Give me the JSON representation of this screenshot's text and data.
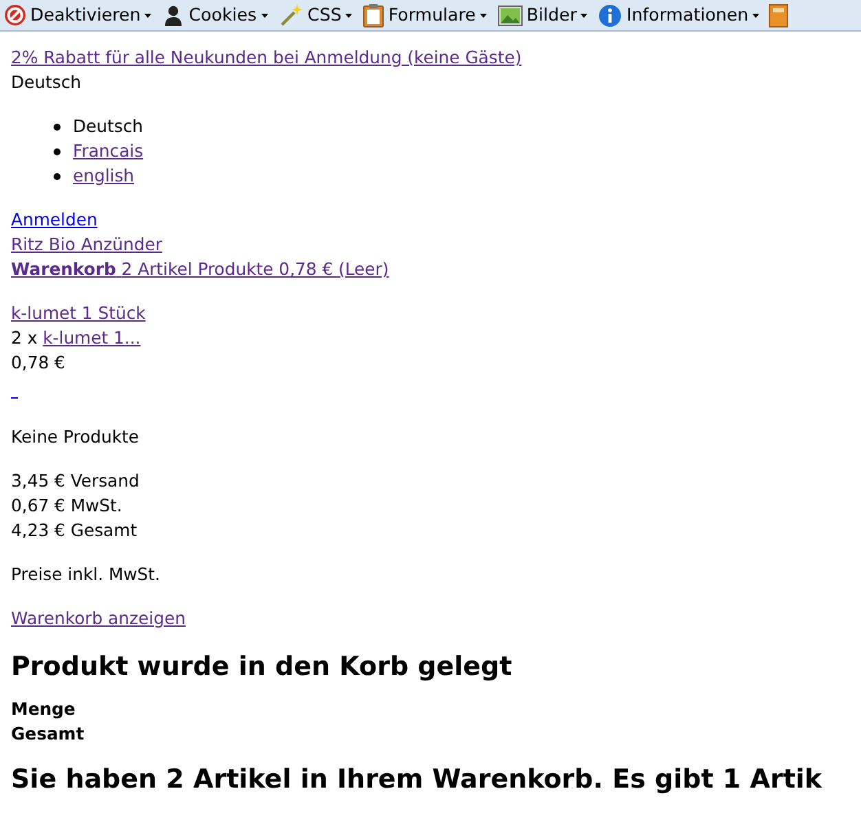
{
  "toolbar": {
    "items": [
      {
        "kind": "disable",
        "label": "Deaktivieren"
      },
      {
        "kind": "cookies",
        "label": "Cookies"
      },
      {
        "kind": "css",
        "label": "CSS"
      },
      {
        "kind": "forms",
        "label": "Formulare"
      },
      {
        "kind": "images",
        "label": "Bilder"
      },
      {
        "kind": "info",
        "label": "Informationen"
      },
      {
        "kind": "misc"
      }
    ]
  },
  "promo": {
    "text": "2% Rabatt für alle Neukunden bei Anmeldung (keine Gäste)",
    "visited": true
  },
  "language": {
    "current": "Deutsch",
    "options": [
      {
        "label": "Deutsch",
        "selected": true
      },
      {
        "label": "Francais",
        "selected": false
      },
      {
        "label": "english",
        "selected": false
      }
    ]
  },
  "account_links": [
    {
      "text": "Anmelden",
      "visited": false
    },
    {
      "text": "Ritz Bio Anzünder",
      "visited": true
    }
  ],
  "cart_link": {
    "title": "Warenkorb",
    "summary": "2 Artikel Produkte 0,78 € (Leer)",
    "visited": true
  },
  "cart_item": {
    "name_link": "k-lumet 1 Stück",
    "quantity": "2 x",
    "short_link": "k-lumet 1...",
    "price": "0,78 €"
  },
  "empty_text": "Keine Produkte",
  "totals": [
    "3,45 € Versand",
    "0,67 € MwSt.",
    "4,23 € Gesamt"
  ],
  "tax_note": "Preise inkl. MwSt.",
  "show_cart_link": "Warenkorb anzeigen",
  "added_heading": "Produkt wurde in den Korb gelegt",
  "labels": [
    "Menge",
    "Gesamt"
  ],
  "summary_heading": "Sie haben 2 Artikel in Ihrem Warenkorb. Es gibt 1 Artik"
}
